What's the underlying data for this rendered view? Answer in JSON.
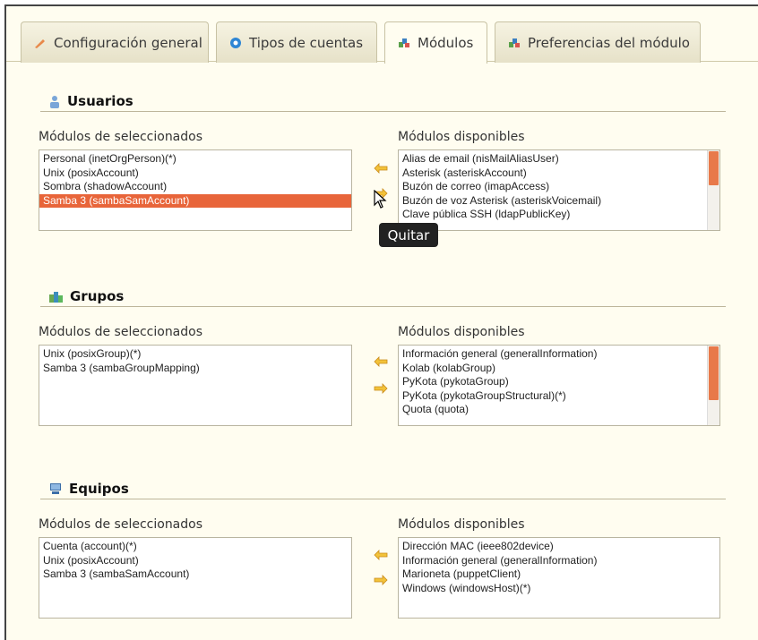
{
  "tabs": [
    {
      "label": "Configuración general",
      "icon": "wrench-icon"
    },
    {
      "label": "Tipos de cuentas",
      "icon": "account-types-icon"
    },
    {
      "label": "Módulos",
      "icon": "modules-icon",
      "active": true
    },
    {
      "label": "Preferencias del módulo",
      "icon": "module-prefs-icon"
    }
  ],
  "sections": {
    "users": {
      "title": "Usuarios",
      "selected_label": "Módulos de seleccionados",
      "available_label": "Módulos disponibles",
      "selected": [
        "Personal (inetOrgPerson)(*)",
        "Unix (posixAccount)",
        "Sombra (shadowAccount)",
        "Samba 3 (sambaSamAccount)"
      ],
      "selected_highlight": "Samba 3 (sambaSamAccount)",
      "available": [
        "Alias de email (nisMailAliasUser)",
        "Asterisk (asteriskAccount)",
        "Buzón de correo (imapAccess)",
        "Buzón de voz Asterisk (asteriskVoicemail)",
        "Clave pública SSH (ldapPublicKey)"
      ]
    },
    "groups": {
      "title": "Grupos",
      "selected_label": "Módulos de seleccionados",
      "available_label": "Módulos disponibles",
      "selected": [
        "Unix (posixGroup)(*)",
        "Samba 3 (sambaGroupMapping)"
      ],
      "available": [
        "Información general (generalInformation)",
        "Kolab (kolabGroup)",
        "PyKota (pykotaGroup)",
        "PyKota (pykotaGroupStructural)(*)",
        "Quota (quota)"
      ]
    },
    "hosts": {
      "title": "Equipos",
      "selected_label": "Módulos de seleccionados",
      "available_label": "Módulos disponibles",
      "selected": [
        "Cuenta (account)(*)",
        "Unix (posixAccount)",
        "Samba 3 (sambaSamAccount)"
      ],
      "available": [
        "Dirección MAC (ieee802device)",
        "Información general (generalInformation)",
        "Marioneta (puppetClient)",
        "Windows (windowsHost)(*)"
      ]
    }
  },
  "tooltip": "Quitar",
  "colors": {
    "accent": "#e8653a",
    "background": "#fffdf0"
  }
}
